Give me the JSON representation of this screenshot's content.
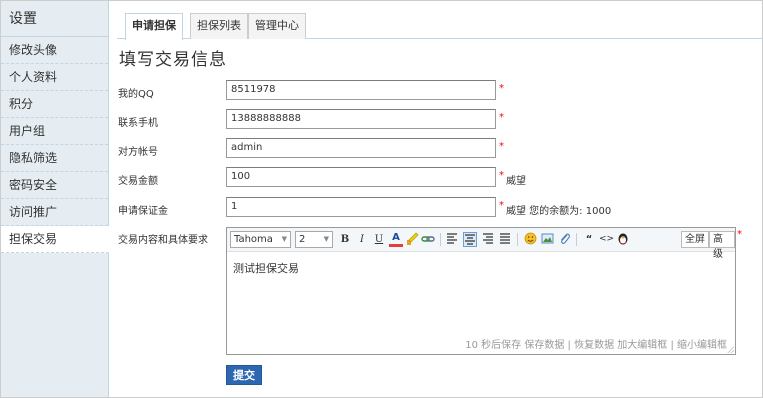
{
  "sidebar": {
    "title": "设置",
    "items": [
      {
        "label": "修改头像"
      },
      {
        "label": "个人资料"
      },
      {
        "label": "积分"
      },
      {
        "label": "用户组"
      },
      {
        "label": "隐私筛选"
      },
      {
        "label": "密码安全"
      },
      {
        "label": "访问推广"
      },
      {
        "label": "担保交易"
      }
    ]
  },
  "tabs": [
    {
      "label": "申请担保"
    },
    {
      "label": "担保列表"
    },
    {
      "label": "管理中心"
    }
  ],
  "form": {
    "heading": "填写交易信息",
    "qq": {
      "label": "我的QQ",
      "value": "8511978"
    },
    "phone": {
      "label": "联系手机",
      "value": "13888888888"
    },
    "account": {
      "label": "对方帐号",
      "value": "admin"
    },
    "amount": {
      "label": "交易金额",
      "value": "100",
      "unit": "威望"
    },
    "deposit": {
      "label": "申请保证金",
      "value": "1",
      "note": "威望 您的余额为: 1000"
    },
    "content": {
      "label": "交易内容和具体要求",
      "text": "测试担保交易"
    },
    "required_mark": "*",
    "submit_label": "提交"
  },
  "editor": {
    "font_family": "Tahoma",
    "font_size": "2",
    "bold": "B",
    "italic": "I",
    "underline": "U",
    "fore_color": "A",
    "quote": "“",
    "code": "<>",
    "fullscreen": "全屏",
    "advanced": "高级",
    "status": "10 秒后保存 保存数据 | 恢复数据   加大编辑框 | 缩小编辑框"
  }
}
